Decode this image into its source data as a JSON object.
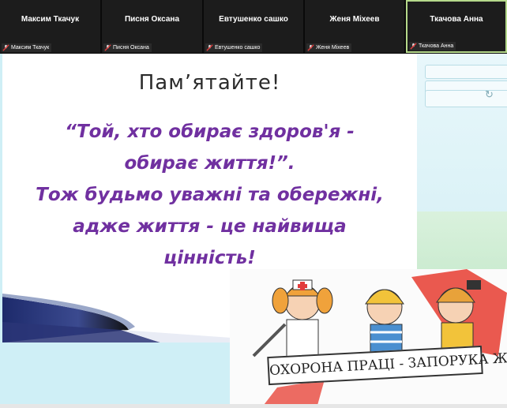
{
  "participants": [
    {
      "name": "Максим Ткачук",
      "label": "Максим Ткачук",
      "muted": true,
      "active": false
    },
    {
      "name": "Писня Оксана",
      "label": "Писня Оксана",
      "muted": true,
      "active": false
    },
    {
      "name": "Евтушенко сашко",
      "label": "Евтушенко сашко",
      "muted": true,
      "active": false
    },
    {
      "name": "Женя Міхеев",
      "label": "Женя Міхеев",
      "muted": true,
      "active": false
    },
    {
      "name": "Ткачова Анна",
      "label": "Ткачова Анна",
      "muted": true,
      "active": true
    }
  ],
  "slide": {
    "title": "Пам’ятайте!",
    "lines": [
      "“Той, хто обирає здоров'я -",
      "обирає життя!”.",
      "Тож будьмо уважні та обережні,",
      "адже життя - це найвища",
      "цінність!"
    ]
  },
  "illustration": {
    "banner_text": "ОХОРОНА ПРАЦІ - ЗАПОРУКА ЖИТТЯ!"
  },
  "icons": {
    "mic": "mic-off-icon",
    "refresh": "refresh-icon"
  },
  "colors": {
    "quote": "#7030a0",
    "active_border": "#b5d98b",
    "mute_red": "#e23b3b"
  }
}
